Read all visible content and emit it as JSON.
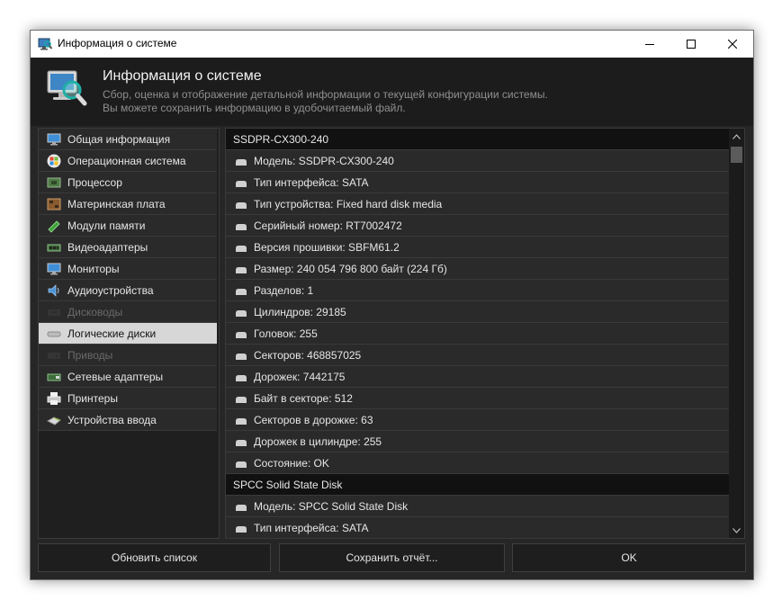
{
  "window": {
    "title": "Информация о системе",
    "controls": {
      "minimize": "minimize",
      "maximize": "maximize",
      "close": "close"
    }
  },
  "header": {
    "title": "Информация о системе",
    "desc_line1": "Сбор, оценка и отображение детальной информации о текущей конфигурации системы.",
    "desc_line2": "Вы можете сохранить информацию в удобочитаемый файл."
  },
  "sidebar": {
    "items": [
      {
        "label": "Общая информация",
        "icon": "monitor-icon",
        "state": "normal"
      },
      {
        "label": "Операционная система",
        "icon": "windows-logo-icon",
        "state": "normal"
      },
      {
        "label": "Процессор",
        "icon": "cpu-icon",
        "state": "normal"
      },
      {
        "label": "Материнская плата",
        "icon": "motherboard-icon",
        "state": "normal"
      },
      {
        "label": "Модули памяти",
        "icon": "memory-module-icon",
        "state": "normal"
      },
      {
        "label": "Видеоадаптеры",
        "icon": "video-card-icon",
        "state": "normal"
      },
      {
        "label": "Мониторы",
        "icon": "monitor-icon",
        "state": "normal"
      },
      {
        "label": "Аудиоустройства",
        "icon": "speaker-icon",
        "state": "normal"
      },
      {
        "label": "Дисководы",
        "icon": "floppy-drive-icon",
        "state": "disabled"
      },
      {
        "label": "Логические диски",
        "icon": "disk-icon",
        "state": "selected"
      },
      {
        "label": "Приводы",
        "icon": "optical-drive-icon",
        "state": "disabled"
      },
      {
        "label": "Сетевые адаптеры",
        "icon": "network-card-icon",
        "state": "normal"
      },
      {
        "label": "Принтеры",
        "icon": "printer-icon",
        "state": "normal"
      },
      {
        "label": "Устройства ввода",
        "icon": "mouse-icon",
        "state": "normal"
      }
    ]
  },
  "details": {
    "rows": [
      {
        "type": "group",
        "text": "SSDPR-CX300-240"
      },
      {
        "type": "item",
        "text": "Модель: SSDPR-CX300-240"
      },
      {
        "type": "item",
        "text": "Тип интерфейса: SATA"
      },
      {
        "type": "item",
        "text": "Тип устройства: Fixed hard disk media"
      },
      {
        "type": "item",
        "text": "Серийный номер: RT7002472"
      },
      {
        "type": "item",
        "text": "Версия прошивки: SBFM61.2"
      },
      {
        "type": "item",
        "text": "Размер: 240 054 796 800 байт (224 Гб)"
      },
      {
        "type": "item",
        "text": "Разделов: 1"
      },
      {
        "type": "item",
        "text": "Цилиндров: 29185"
      },
      {
        "type": "item",
        "text": "Головок: 255"
      },
      {
        "type": "item",
        "text": "Секторов: 468857025"
      },
      {
        "type": "item",
        "text": "Дорожек: 7442175"
      },
      {
        "type": "item",
        "text": "Байт в секторе: 512"
      },
      {
        "type": "item",
        "text": "Секторов в дорожке: 63"
      },
      {
        "type": "item",
        "text": "Дорожек в цилиндре: 255"
      },
      {
        "type": "item",
        "text": "Состояние: OK"
      },
      {
        "type": "group",
        "text": "SPCC Solid State Disk"
      },
      {
        "type": "item",
        "text": "Модель: SPCC Solid State Disk"
      },
      {
        "type": "item",
        "text": "Тип интерфейса: SATA"
      }
    ]
  },
  "buttons": {
    "refresh": "Обновить список",
    "save": "Сохранить отчёт...",
    "ok": "OK"
  },
  "colors": {
    "window_bg": "#262626",
    "row_bg": "#2a2a2a",
    "group_bg": "#111111",
    "selected_bg": "#d7d7d7",
    "text": "#e6e6e6",
    "disabled_text": "#6a6a6a"
  }
}
